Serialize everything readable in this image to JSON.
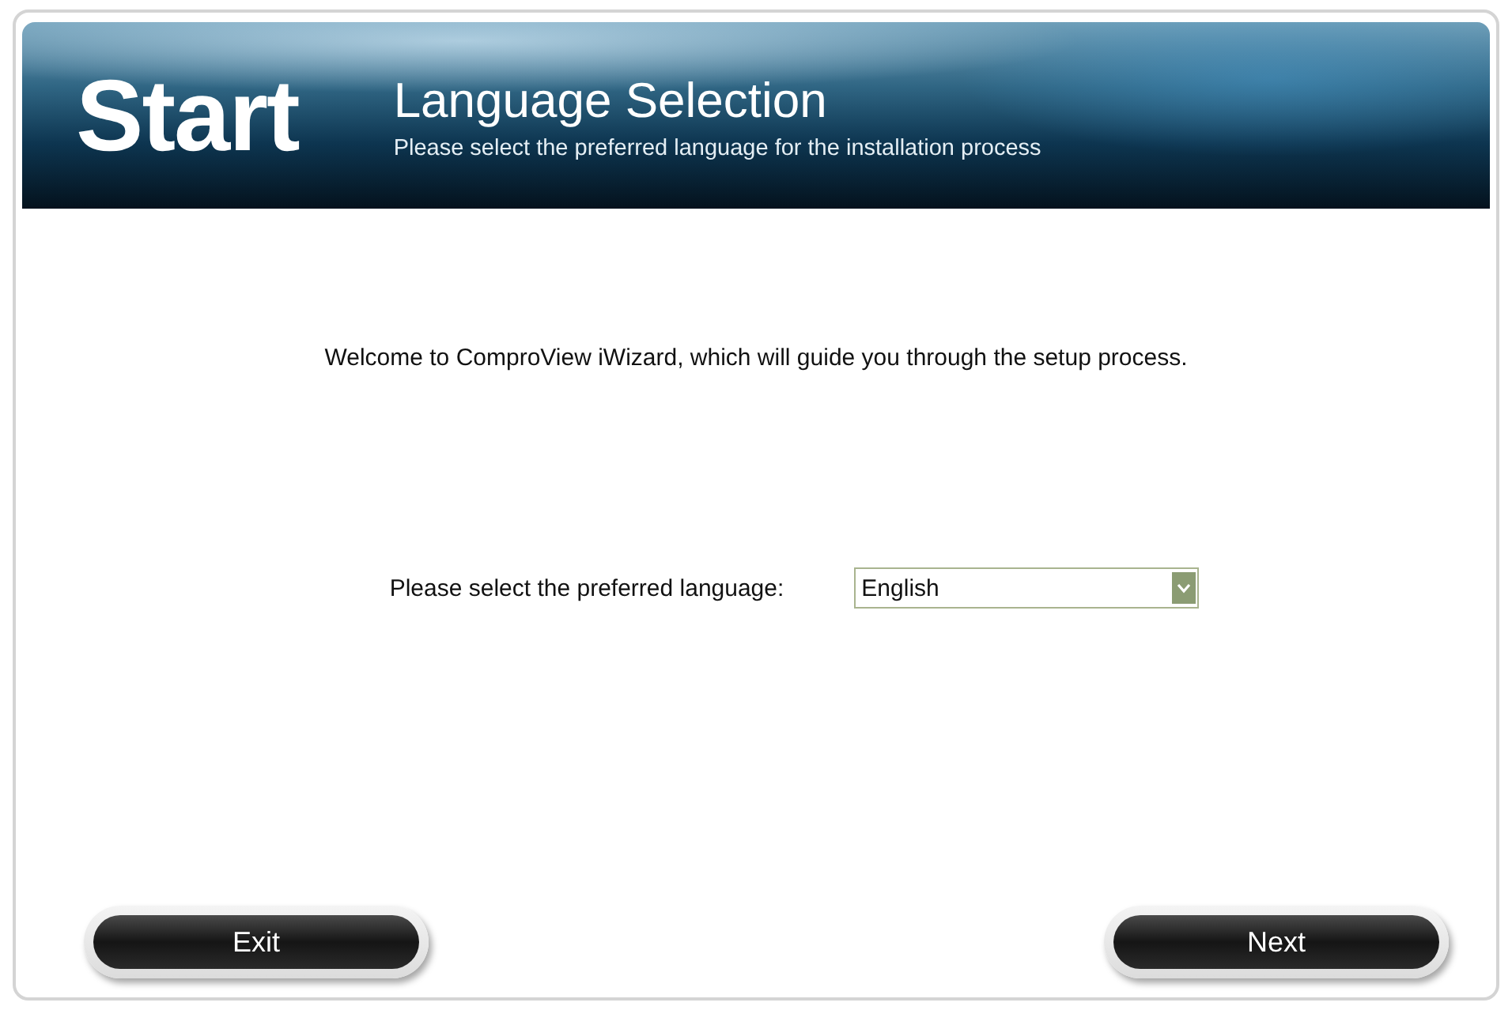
{
  "header": {
    "logo_text": "Start",
    "title": "Language Selection",
    "subtitle": "Please select the preferred language for the installation process"
  },
  "welcome": "Welcome to ComproView iWizard, which will guide you through the setup process.",
  "language": {
    "label": "Please select the preferred language:",
    "value": "English"
  },
  "buttons": [
    {
      "label": "Exit"
    },
    {
      "label": "Next"
    }
  ]
}
